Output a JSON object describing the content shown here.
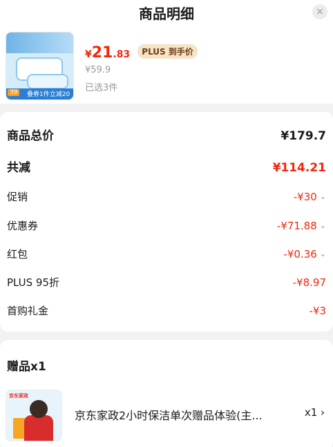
{
  "header": {
    "title": "商品明细",
    "close_icon": "×"
  },
  "product": {
    "price_symbol": "¥",
    "price_int": "21",
    "price_dec": ".83",
    "plus_tag": "PLUS 到手价",
    "original_price": "¥59.9",
    "selected_count": "已选3件",
    "thumb_badge_price": "39",
    "thumb_badge_text": "叠券1件立减20"
  },
  "summary": {
    "rows": [
      {
        "label": "商品总价",
        "value": "¥179.7",
        "chevron": false
      },
      {
        "label": "共减",
        "value": "¥114.21",
        "chevron": false
      },
      {
        "label": "促销",
        "value": "-¥30",
        "chevron": true
      },
      {
        "label": "优惠券",
        "value": "-¥71.88",
        "chevron": true
      },
      {
        "label": "红包",
        "value": "-¥0.36",
        "chevron": true
      },
      {
        "label": "PLUS 95折",
        "value": "-¥8.97",
        "chevron": false
      },
      {
        "label": "首购礼金",
        "value": "-¥3",
        "chevron": false
      }
    ],
    "chevron_glyph": "⌄"
  },
  "gift": {
    "title": "赠品x1",
    "thumb_logo": "京东家政",
    "name": "京东家政2小时保洁单次赠品体验(主...",
    "qty": "x1 ›"
  },
  "colors": {
    "accent": "#f2270c",
    "plus_tag_bg": "#f7e3c8",
    "text": "#1a1a1a",
    "muted": "#999999"
  }
}
